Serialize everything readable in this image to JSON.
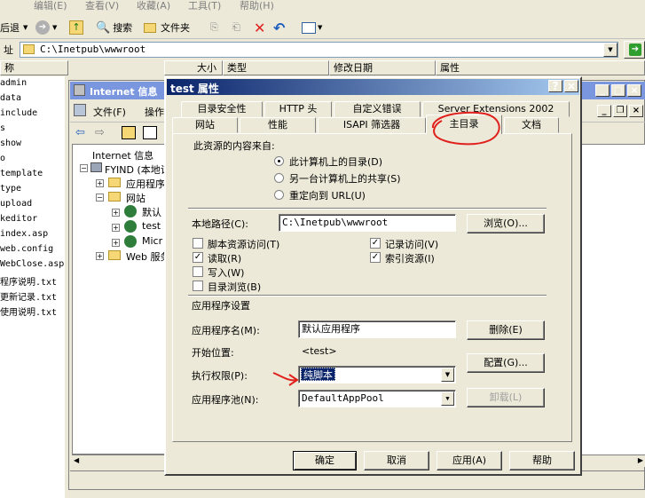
{
  "explorer": {
    "menu": [
      "编辑(E)",
      "查看(V)",
      "收藏(A)",
      "工具(T)",
      "帮助(H)"
    ],
    "toolbar": {
      "back": "后退",
      "search": "搜索",
      "folders": "文件夹"
    },
    "address_label": "址",
    "address_value": "C:\\Inetpub\\wwwroot",
    "columns": [
      "称",
      "大小",
      "类型",
      "修改日期",
      "属性"
    ],
    "files": [
      "admin",
      "data",
      "include",
      "s",
      "show",
      "o",
      "template",
      "type",
      "upload",
      "keditor",
      "index.asp",
      "web.config",
      "WebClose.asp",
      "程序说明.txt",
      "更新记录.txt",
      "使用说明.txt"
    ]
  },
  "iis": {
    "title": "Internet 信息",
    "menu": [
      "文件(F)",
      "操作"
    ],
    "tree": [
      "Internet 信息",
      "FYIND (本地计",
      "应用程序",
      "网站",
      "默认",
      "test",
      "Micr",
      "Web 服务"
    ],
    "right_header": "况"
  },
  "dialog": {
    "title": "test 属性",
    "help_btn": "?",
    "close_btn": "×",
    "tabs_row1": [
      "目录安全性",
      "HTTP 头",
      "自定义错误",
      "Server Extensions 2002"
    ],
    "tabs_row2": [
      "网站",
      "性能",
      "ISAPI 筛选器",
      "主目录",
      "文档"
    ],
    "content_from_label": "此资源的内容来自:",
    "radio_options": [
      "此计算机上的目录(D)",
      "另一台计算机上的共享(S)",
      "重定向到 URL(U)"
    ],
    "local_path_label": "本地路径(C):",
    "local_path_value": "C:\\Inetpub\\wwwroot",
    "browse_btn": "浏览(O)...",
    "checkboxes_left": [
      {
        "label": "脚本资源访问(T)",
        "checked": false
      },
      {
        "label": "读取(R)",
        "checked": true
      },
      {
        "label": "写入(W)",
        "checked": false
      },
      {
        "label": "目录浏览(B)",
        "checked": false
      }
    ],
    "checkboxes_right": [
      {
        "label": "记录访问(V)",
        "checked": true
      },
      {
        "label": "索引资源(I)",
        "checked": true
      }
    ],
    "app_settings_label": "应用程序设置",
    "app_name_label": "应用程序名(M):",
    "app_name_value": "默认应用程序",
    "remove_btn": "删除(E)",
    "start_point_label": "开始位置:",
    "start_point_value": "<test>",
    "config_btn": "配置(G)...",
    "exec_perm_label": "执行权限(P):",
    "exec_perm_value": "纯脚本",
    "app_pool_label": "应用程序池(N):",
    "app_pool_value": "DefaultAppPool",
    "unload_btn": "卸载(L)",
    "ok_btn": "确定",
    "cancel_btn": "取消",
    "apply_btn": "应用(A)",
    "help_bottom_btn": "帮助",
    "colors": {
      "annotation": "#e0201c",
      "selection": "#0a246a"
    }
  }
}
